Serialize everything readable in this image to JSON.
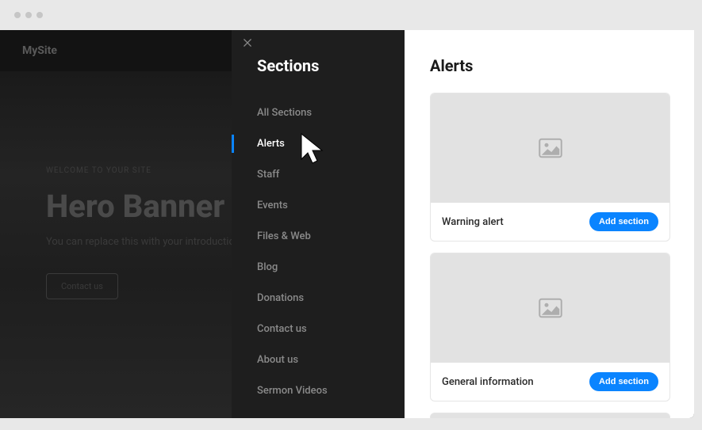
{
  "site": {
    "name": "MySite"
  },
  "hero": {
    "eyebrow": "WELCOME TO YOUR SITE",
    "title": "Hero Banner",
    "subtitle": "You can replace this with your introduction text.",
    "cta": "Contact us"
  },
  "panel": {
    "title": "Sections",
    "items": [
      {
        "label": "All Sections",
        "active": false
      },
      {
        "label": "Alerts",
        "active": true
      },
      {
        "label": "Staff",
        "active": false
      },
      {
        "label": "Events",
        "active": false
      },
      {
        "label": "Files & Web",
        "active": false
      },
      {
        "label": "Blog",
        "active": false
      },
      {
        "label": "Donations",
        "active": false
      },
      {
        "label": "Contact us",
        "active": false
      },
      {
        "label": "About us",
        "active": false
      },
      {
        "label": "Sermon Videos",
        "active": false
      }
    ]
  },
  "main": {
    "title": "Alerts",
    "add_label": "Add section",
    "cards": [
      {
        "label": "Warning alert"
      },
      {
        "label": "General information"
      }
    ]
  }
}
